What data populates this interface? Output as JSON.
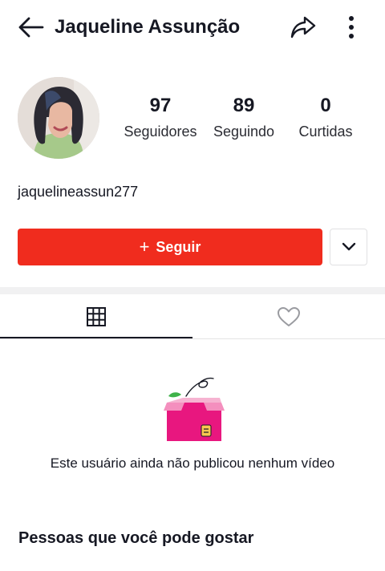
{
  "header": {
    "title": "Jaqueline Assunção",
    "back_icon": "arrow-left-icon",
    "share_icon": "share-icon",
    "more_icon": "more-vertical-icon"
  },
  "profile": {
    "username": "jaquelineassun277",
    "stats": {
      "followers": {
        "value": "97",
        "label": "Seguidores"
      },
      "following": {
        "value": "89",
        "label": "Seguindo"
      },
      "likes": {
        "value": "0",
        "label": "Curtidas"
      }
    }
  },
  "actions": {
    "follow_label": "Seguir",
    "follow_icon": "plus-icon",
    "dropdown_icon": "chevron-down-icon"
  },
  "tabs": {
    "videos_icon": "grid-icon",
    "liked_icon": "heart-icon",
    "active": "videos"
  },
  "empty_state": {
    "icon": "empty-box-icon",
    "message": "Este usuário ainda não publicou nenhum vídeo"
  },
  "suggestions": {
    "title": "Pessoas que você pode gostar"
  },
  "colors": {
    "accent": "#f02c1e",
    "text": "#161823",
    "box": "#e8177f"
  }
}
